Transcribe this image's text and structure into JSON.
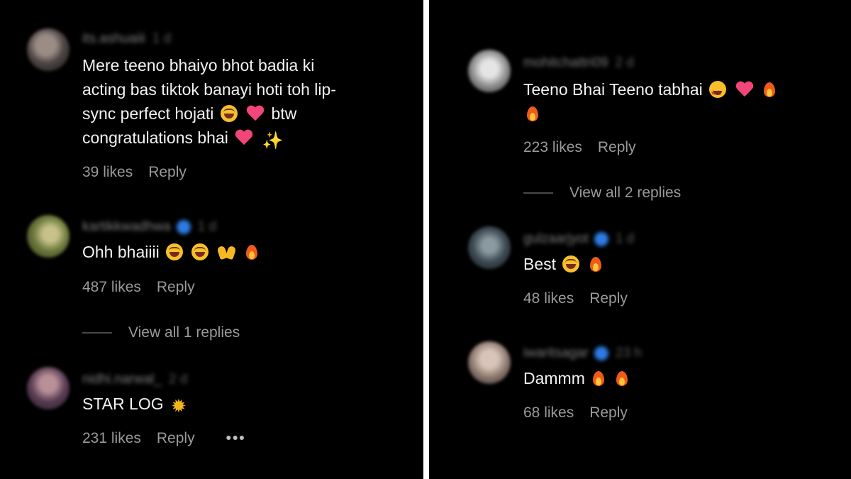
{
  "left_panel": {
    "comments": [
      {
        "username": "its.ashuaiii",
        "time": "1 d",
        "verified": false,
        "lines": [
          "Mere teeno bhaiyo bhot badia ki",
          "acting bas tiktok banayi hoti toh lip-",
          "sync perfect hojati",
          "congratulations bhai"
        ],
        "inline_text": "btw",
        "emojis": [
          "laughing-tears-icon",
          "heart-icon",
          "heart-icon",
          "sparkles-icon"
        ],
        "likes": "39 likes",
        "reply": "Reply"
      },
      {
        "username": "kartikkwadhwa",
        "time": "1 d",
        "verified": true,
        "text": "Ohh bhaiiii",
        "emojis": [
          "laughing-tears-icon",
          "laughing-tears-icon",
          "raised-hands-icon",
          "fire-icon"
        ],
        "likes": "487 likes",
        "reply": "Reply",
        "view_replies": "View all 1 replies"
      },
      {
        "username": "nidhi.narwal_",
        "time": "2 d",
        "verified": false,
        "text": "STAR LOG",
        "emojis": [
          "sun-icon"
        ],
        "likes": "231 likes",
        "reply": "Reply",
        "more": "•••"
      }
    ]
  },
  "right_panel": {
    "comments": [
      {
        "username": "mohitchattri09",
        "time": "2 d",
        "verified": false,
        "text": "Teeno Bhai Teeno tabhai",
        "emojis": [
          "star-struck-icon",
          "heart-icon",
          "fire-icon",
          "fire-icon"
        ],
        "likes": "223 likes",
        "reply": "Reply",
        "view_replies": "View all 2 replies"
      },
      {
        "username": "gulzaarjyot",
        "time": "1 d",
        "verified": true,
        "text": "Best",
        "emojis": [
          "laughing-tears-icon",
          "fire-icon"
        ],
        "likes": "48 likes",
        "reply": "Reply"
      },
      {
        "username": "iwaritsagar",
        "time": "23 h",
        "verified": true,
        "text": "Dammm",
        "emojis": [
          "fire-icon",
          "fire-icon"
        ],
        "likes": "68 likes",
        "reply": "Reply"
      }
    ]
  },
  "colors": {
    "background": "#000000",
    "divider": "#ffffff",
    "text_primary": "#f2f2f2",
    "text_secondary": "#9a9a9a",
    "verified_badge": "#2e7be4"
  }
}
